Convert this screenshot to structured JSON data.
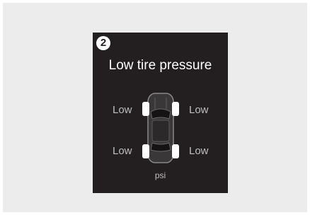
{
  "step_badge": "2",
  "warning": {
    "title": "Low tire pressure",
    "tires": {
      "front_left": "Low",
      "front_right": "Low",
      "rear_left": "Low",
      "rear_right": "Low"
    },
    "unit": "psi"
  },
  "icons": [
    "car-top-view-icon"
  ],
  "colors": {
    "screen_background": "#231f20",
    "text": "#ffffff",
    "label_text": "#bfbfbf"
  }
}
